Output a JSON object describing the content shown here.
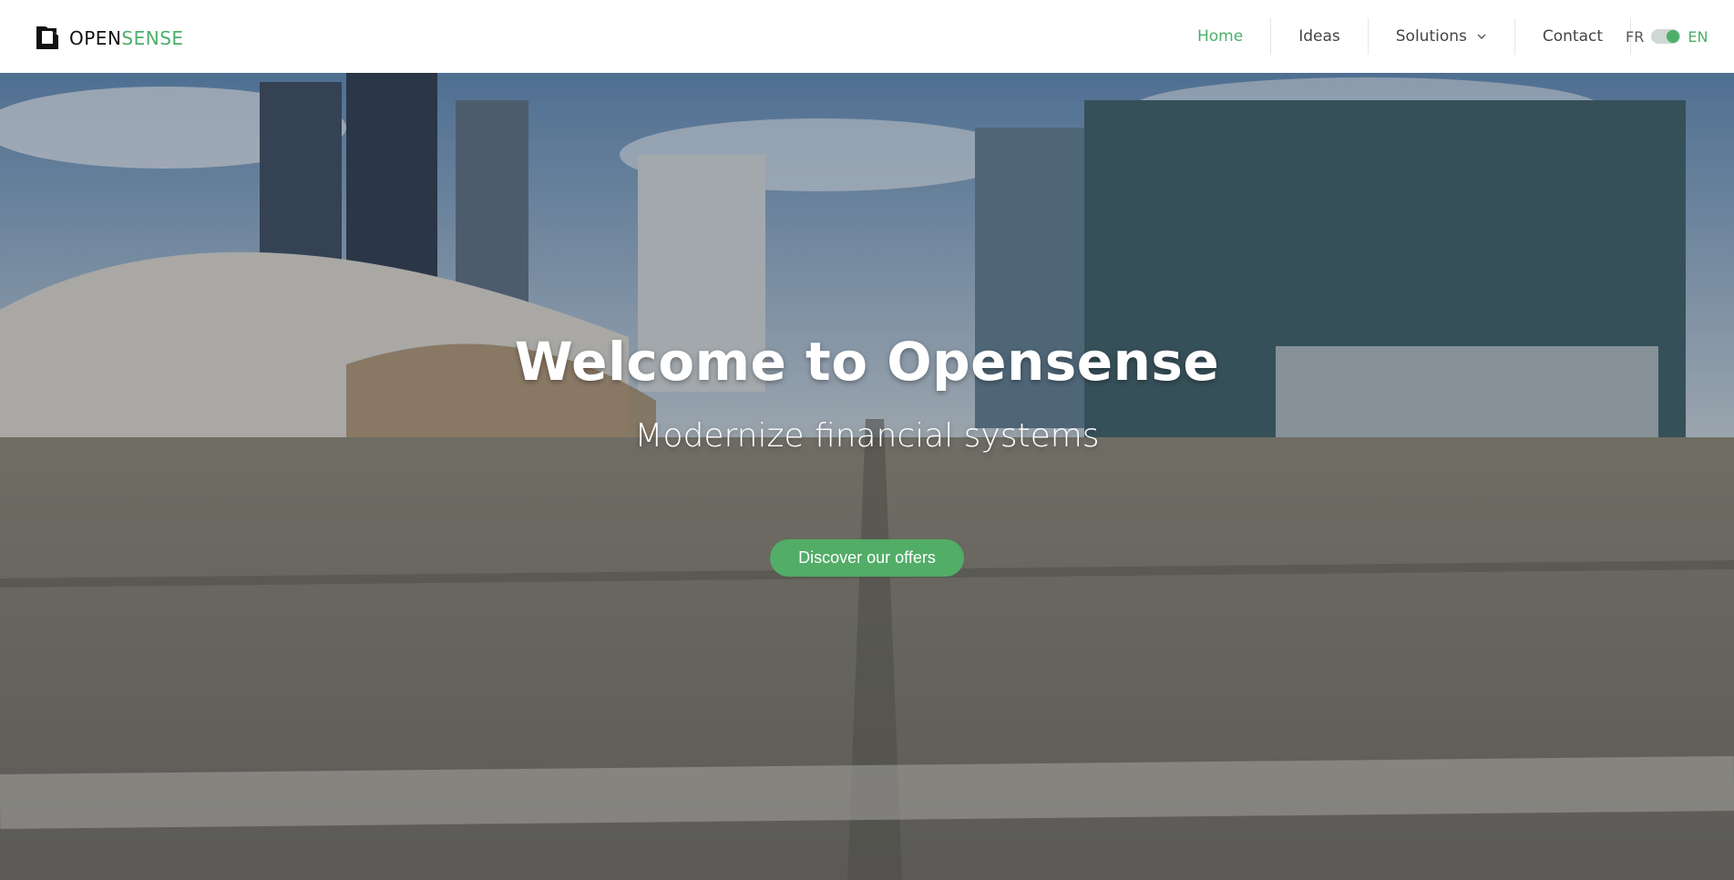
{
  "brand": {
    "logo_icon": "opensense-logo-icon",
    "name_part1": "OPEN",
    "name_part2": "SENSE",
    "accent_color": "#4caf6a"
  },
  "nav": {
    "items": [
      {
        "label": "Home",
        "active": true
      },
      {
        "label": "Ideas",
        "active": false
      },
      {
        "label": "Solutions",
        "active": false,
        "icon": "chevron-down-icon"
      },
      {
        "label": "Contact",
        "active": false
      }
    ]
  },
  "lang": {
    "fr": "FR",
    "en": "EN",
    "selected": "EN"
  },
  "hero": {
    "title": "Welcome to Opensense",
    "subtitle": "Modernize financial systems",
    "cta": "Discover our offers",
    "cta_color": "#52ad67"
  }
}
